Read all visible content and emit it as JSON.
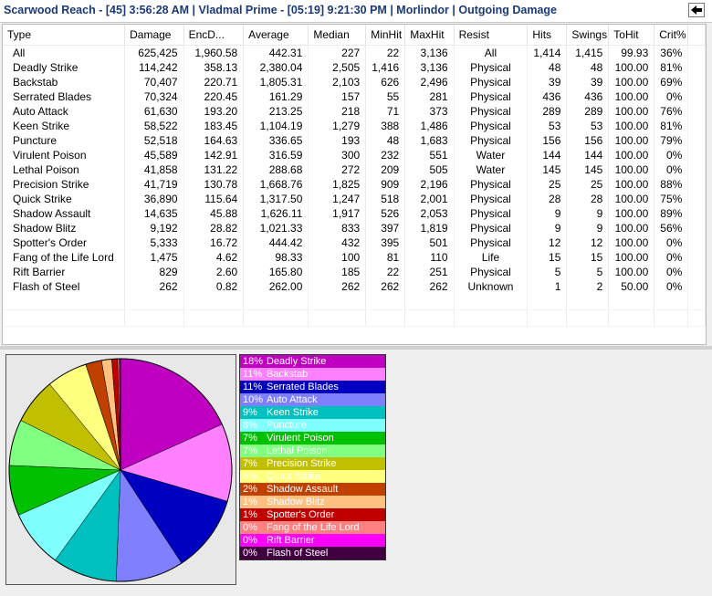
{
  "window": {
    "title": "Scarwood Reach - [45] 3:56:28 AM | Vladmal Prime - [05:19] 9:21:30 PM | Morlindor | Outgoing Damage"
  },
  "table": {
    "columns": [
      "Type",
      "Damage",
      "EncD...",
      "Average",
      "Median",
      "MinHit",
      "MaxHit",
      "Resist",
      "Hits",
      "Swings",
      "ToHit",
      "Crit%"
    ],
    "sort_column": "EncD...",
    "rows": [
      [
        "All",
        "625,425",
        "1,960.58",
        "442.31",
        "227",
        "22",
        "3,136",
        "All",
        "1,414",
        "1,415",
        "99.93",
        "36%"
      ],
      [
        "Deadly Strike",
        "114,242",
        "358.13",
        "2,380.04",
        "2,505",
        "1,416",
        "3,136",
        "Physical",
        "48",
        "48",
        "100.00",
        "81%"
      ],
      [
        "Backstab",
        "70,407",
        "220.71",
        "1,805.31",
        "2,103",
        "626",
        "2,496",
        "Physical",
        "39",
        "39",
        "100.00",
        "69%"
      ],
      [
        "Serrated Blades",
        "70,324",
        "220.45",
        "161.29",
        "157",
        "55",
        "281",
        "Physical",
        "436",
        "436",
        "100.00",
        "0%"
      ],
      [
        "Auto Attack",
        "61,630",
        "193.20",
        "213.25",
        "218",
        "71",
        "373",
        "Physical",
        "289",
        "289",
        "100.00",
        "76%"
      ],
      [
        "Keen Strike",
        "58,522",
        "183.45",
        "1,104.19",
        "1,279",
        "388",
        "1,486",
        "Physical",
        "53",
        "53",
        "100.00",
        "81%"
      ],
      [
        "Puncture",
        "52,518",
        "164.63",
        "336.65",
        "193",
        "48",
        "1,683",
        "Physical",
        "156",
        "156",
        "100.00",
        "79%"
      ],
      [
        "Virulent Poison",
        "45,589",
        "142.91",
        "316.59",
        "300",
        "232",
        "551",
        "Water",
        "144",
        "144",
        "100.00",
        "0%"
      ],
      [
        "Lethal Poison",
        "41,858",
        "131.22",
        "288.68",
        "272",
        "209",
        "505",
        "Water",
        "145",
        "145",
        "100.00",
        "0%"
      ],
      [
        "Precision Strike",
        "41,719",
        "130.78",
        "1,668.76",
        "1,825",
        "909",
        "2,196",
        "Physical",
        "25",
        "25",
        "100.00",
        "88%"
      ],
      [
        "Quick Strike",
        "36,890",
        "115.64",
        "1,317.50",
        "1,247",
        "518",
        "2,001",
        "Physical",
        "28",
        "28",
        "100.00",
        "75%"
      ],
      [
        "Shadow Assault",
        "14,635",
        "45.88",
        "1,626.11",
        "1,917",
        "526",
        "2,053",
        "Physical",
        "9",
        "9",
        "100.00",
        "89%"
      ],
      [
        "Shadow Blitz",
        "9,192",
        "28.82",
        "1,021.33",
        "833",
        "397",
        "1,819",
        "Physical",
        "9",
        "9",
        "100.00",
        "56%"
      ],
      [
        "Spotter's Order",
        "5,333",
        "16.72",
        "444.42",
        "432",
        "395",
        "501",
        "Physical",
        "12",
        "12",
        "100.00",
        "0%"
      ],
      [
        "Fang of the Life Lord",
        "1,475",
        "4.62",
        "98.33",
        "100",
        "81",
        "110",
        "Life",
        "15",
        "15",
        "100.00",
        "0%"
      ],
      [
        "Rift Barrier",
        "829",
        "2.60",
        "165.80",
        "185",
        "22",
        "251",
        "Physical",
        "5",
        "5",
        "100.00",
        "0%"
      ],
      [
        "Flash of Steel",
        "262",
        "0.82",
        "262.00",
        "262",
        "262",
        "262",
        "Unknown",
        "1",
        "2",
        "50.00",
        "0%"
      ]
    ]
  },
  "legend": [
    {
      "pct": "18%",
      "name": "Deadly Strike",
      "color": "#c000c0",
      "text": "#ffffff"
    },
    {
      "pct": "11%",
      "name": "Backstab",
      "color": "#ff80ff",
      "text": "#ffffff"
    },
    {
      "pct": "11%",
      "name": "Serrated Blades",
      "color": "#0000c0",
      "text": "#ffffff"
    },
    {
      "pct": "10%",
      "name": "Auto Attack",
      "color": "#8080ff",
      "text": "#ffffff"
    },
    {
      "pct": "9%",
      "name": "Keen Strike",
      "color": "#00c0c0",
      "text": "#ffffff"
    },
    {
      "pct": "8%",
      "name": "Puncture",
      "color": "#80ffff",
      "text": "#ffffff"
    },
    {
      "pct": "7%",
      "name": "Virulent Poison",
      "color": "#00c000",
      "text": "#ffffff"
    },
    {
      "pct": "7%",
      "name": "Lethal Poison",
      "color": "#80ff80",
      "text": "#ffffff"
    },
    {
      "pct": "7%",
      "name": "Precision Strike",
      "color": "#c0c000",
      "text": "#ffffff"
    },
    {
      "pct": "6%",
      "name": "Quick Strike",
      "color": "#ffff80",
      "text": "#ffffff"
    },
    {
      "pct": "2%",
      "name": "Shadow Assault",
      "color": "#c04000",
      "text": "#ffffff"
    },
    {
      "pct": "1%",
      "name": "Shadow Blitz",
      "color": "#ffc080",
      "text": "#ffffff"
    },
    {
      "pct": "1%",
      "name": "Spotter's Order",
      "color": "#c00000",
      "text": "#ffffff"
    },
    {
      "pct": "0%",
      "name": "Fang of the Life Lord",
      "color": "#ff8080",
      "text": "#ffffff"
    },
    {
      "pct": "0%",
      "name": "Rift Barrier",
      "color": "#ff00ff",
      "text": "#ffffff"
    },
    {
      "pct": "0%",
      "name": "Flash of Steel",
      "color": "#400040",
      "text": "#ffffff"
    }
  ],
  "chart_data": {
    "type": "pie",
    "slices": [
      {
        "label": "Deadly Strike",
        "value": 114242
      },
      {
        "label": "Backstab",
        "value": 70407
      },
      {
        "label": "Serrated Blades",
        "value": 70324
      },
      {
        "label": "Auto Attack",
        "value": 61630
      },
      {
        "label": "Keen Strike",
        "value": 58522
      },
      {
        "label": "Puncture",
        "value": 52518
      },
      {
        "label": "Virulent Poison",
        "value": 45589
      },
      {
        "label": "Lethal Poison",
        "value": 41858
      },
      {
        "label": "Precision Strike",
        "value": 41719
      },
      {
        "label": "Quick Strike",
        "value": 36890
      },
      {
        "label": "Shadow Assault",
        "value": 14635
      },
      {
        "label": "Shadow Blitz",
        "value": 9192
      },
      {
        "label": "Spotter's Order",
        "value": 5333
      },
      {
        "label": "Fang of the Life Lord",
        "value": 1475
      },
      {
        "label": "Rift Barrier",
        "value": 829
      },
      {
        "label": "Flash of Steel",
        "value": 262
      }
    ]
  }
}
